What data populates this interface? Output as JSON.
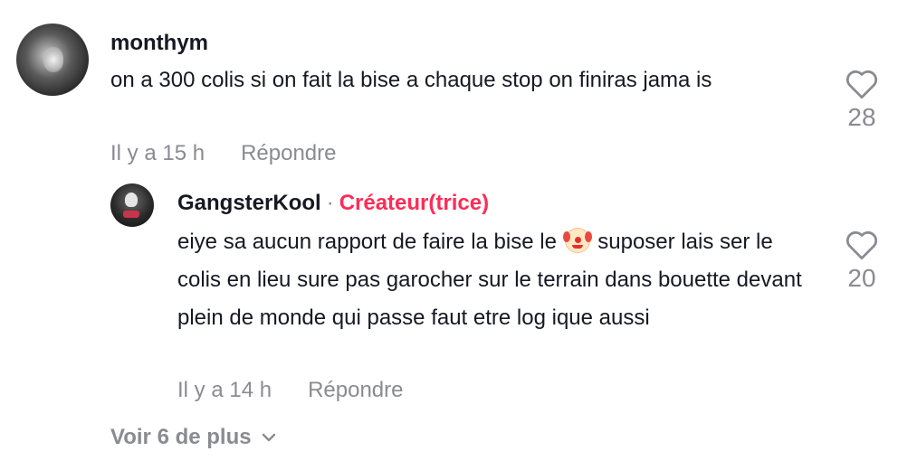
{
  "comment": {
    "username": "monthym",
    "text": "on a 300 colis si on fait la bise a chaque stop on finiras jama is",
    "time": "Il y a 15 h",
    "reply_label": "Répondre",
    "likes": "28"
  },
  "reply": {
    "username": "GangsterKool",
    "separator": "·",
    "badge": "Créateur(trice)",
    "text_before_emoji": "eiye sa aucun rapport de faire la bise le",
    "emoji": "clown-face-emoji",
    "text_after_emoji": "suposer lais ser le colis en lieu sure pas garocher sur le terrain dans bouette devant plein de monde qui passe faut etre log ique aussi",
    "time": "Il y a 14 h",
    "reply_label": "Répondre",
    "likes": "20"
  },
  "more_replies_label": "Voir 6 de plus",
  "colors": {
    "text": "#161823",
    "secondary": "#8a8b91",
    "creator_badge": "#fe2c55"
  },
  "icons": {
    "like": "heart-outline-icon",
    "expand": "chevron-down-icon"
  }
}
